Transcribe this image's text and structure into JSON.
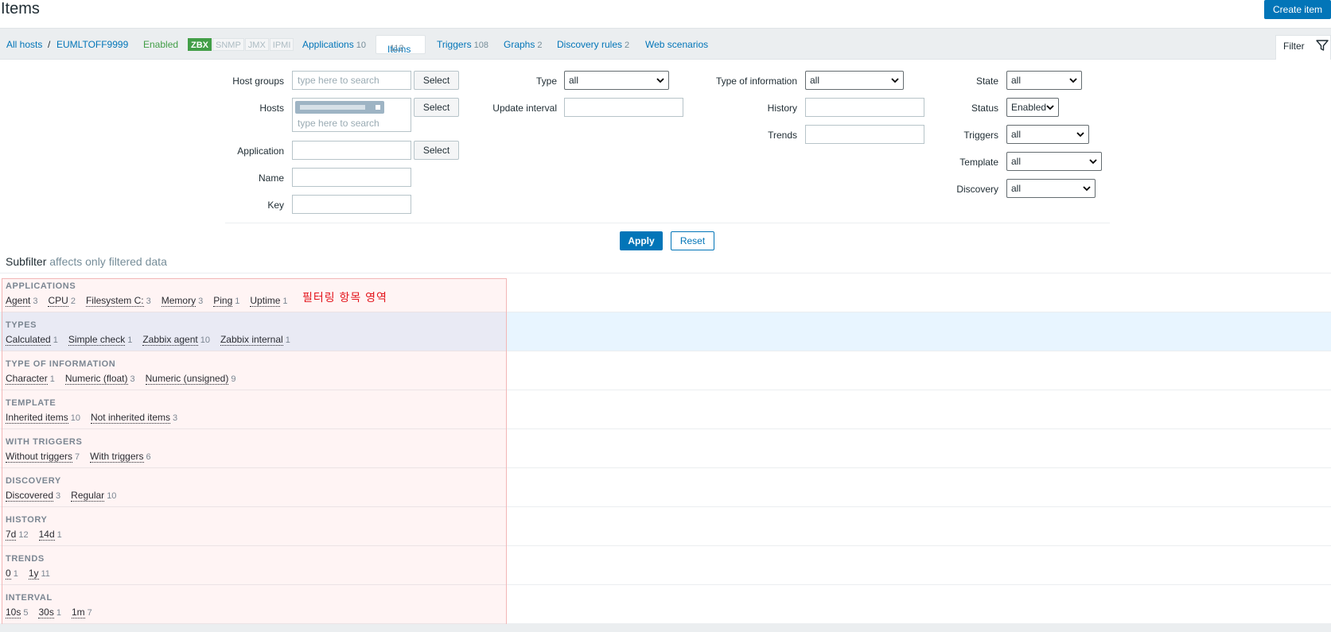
{
  "header": {
    "title": "Items",
    "create_button": "Create item"
  },
  "host_nav": {
    "all_hosts": "All hosts",
    "separator": "/",
    "host": "EUMLTOFF9999",
    "status": "Enabled",
    "availability": [
      "ZBX",
      "SNMP",
      "JMX",
      "IPMI"
    ],
    "tabs": [
      {
        "label": "Applications",
        "count": "10"
      },
      {
        "label": "Items",
        "count": "112"
      },
      {
        "label": "Triggers",
        "count": "108"
      },
      {
        "label": "Graphs",
        "count": "2"
      },
      {
        "label": "Discovery rules",
        "count": "2"
      },
      {
        "label": "Web scenarios",
        "count": ""
      }
    ],
    "filter_tab": "Filter"
  },
  "filter": {
    "host_groups": {
      "label": "Host groups",
      "placeholder": "type here to search",
      "button": "Select"
    },
    "hosts": {
      "label": "Hosts",
      "placeholder": "type here to search",
      "button": "Select"
    },
    "application": {
      "label": "Application",
      "value": "",
      "button": "Select"
    },
    "name": {
      "label": "Name",
      "value": ""
    },
    "key": {
      "label": "Key",
      "value": ""
    },
    "type": {
      "label": "Type",
      "value": "all"
    },
    "update_interval": {
      "label": "Update interval",
      "value": ""
    },
    "type_of_information": {
      "label": "Type of information",
      "value": "all"
    },
    "history": {
      "label": "History",
      "value": ""
    },
    "trends": {
      "label": "Trends",
      "value": ""
    },
    "state": {
      "label": "State",
      "value": "all"
    },
    "status": {
      "label": "Status",
      "value": "Enabled"
    },
    "triggers": {
      "label": "Triggers",
      "value": "all"
    },
    "template": {
      "label": "Template",
      "value": "all"
    },
    "discovery": {
      "label": "Discovery",
      "value": "all"
    },
    "apply": "Apply",
    "reset": "Reset"
  },
  "subfilter": {
    "title": "Subfilter",
    "note": "affects only filtered data",
    "annotation": "필터링 항목 영역",
    "groups": [
      {
        "title": "APPLICATIONS",
        "items": [
          {
            "label": "Agent",
            "count": "3"
          },
          {
            "label": "CPU",
            "count": "2"
          },
          {
            "label": "Filesystem C:",
            "count": "3"
          },
          {
            "label": "Memory",
            "count": "3"
          },
          {
            "label": "Ping",
            "count": "1"
          },
          {
            "label": "Uptime",
            "count": "1"
          }
        ]
      },
      {
        "title": "TYPES",
        "items": [
          {
            "label": "Calculated",
            "count": "1"
          },
          {
            "label": "Simple check",
            "count": "1"
          },
          {
            "label": "Zabbix agent",
            "count": "10"
          },
          {
            "label": "Zabbix internal",
            "count": "1"
          }
        ]
      },
      {
        "title": "TYPE OF INFORMATION",
        "items": [
          {
            "label": "Character",
            "count": "1"
          },
          {
            "label": "Numeric (float)",
            "count": "3"
          },
          {
            "label": "Numeric (unsigned)",
            "count": "9"
          }
        ]
      },
      {
        "title": "TEMPLATE",
        "items": [
          {
            "label": "Inherited items",
            "count": "10"
          },
          {
            "label": "Not inherited items",
            "count": "3"
          }
        ]
      },
      {
        "title": "WITH TRIGGERS",
        "items": [
          {
            "label": "Without triggers",
            "count": "7"
          },
          {
            "label": "With triggers",
            "count": "6"
          }
        ]
      },
      {
        "title": "DISCOVERY",
        "items": [
          {
            "label": "Discovered",
            "count": "3"
          },
          {
            "label": "Regular",
            "count": "10"
          }
        ]
      },
      {
        "title": "HISTORY",
        "items": [
          {
            "label": "7d",
            "count": "12"
          },
          {
            "label": "14d",
            "count": "1"
          }
        ]
      },
      {
        "title": "TRENDS",
        "items": [
          {
            "label": "0",
            "count": "1"
          },
          {
            "label": "1y",
            "count": "11"
          }
        ]
      },
      {
        "title": "INTERVAL",
        "items": [
          {
            "label": "10s",
            "count": "5"
          },
          {
            "label": "30s",
            "count": "1"
          },
          {
            "label": "1m",
            "count": "7"
          }
        ]
      }
    ]
  }
}
